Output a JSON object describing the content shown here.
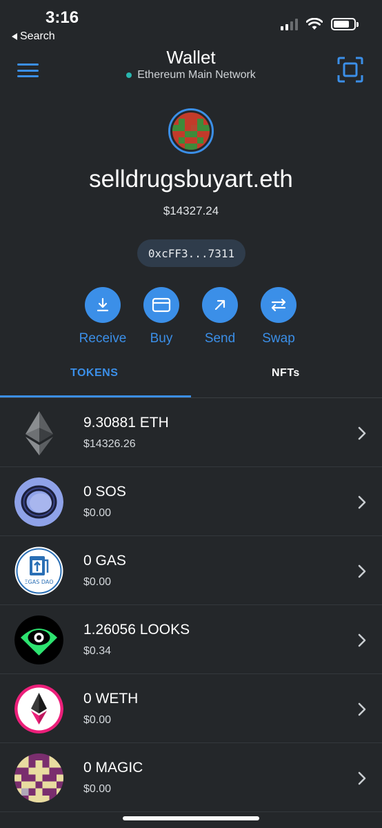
{
  "status_bar": {
    "time": "3:16",
    "back_label": "Search"
  },
  "header": {
    "title": "Wallet",
    "network": "Ethereum Main Network"
  },
  "account": {
    "name": "selldrugsbuyart.eth",
    "balance": "$14327.24",
    "address": "0xcFF3...7311"
  },
  "actions": [
    {
      "label": "Receive",
      "icon": "download-icon"
    },
    {
      "label": "Buy",
      "icon": "card-icon"
    },
    {
      "label": "Send",
      "icon": "arrow-up-right-icon"
    },
    {
      "label": "Swap",
      "icon": "swap-icon"
    }
  ],
  "tabs": [
    {
      "label": "TOKENS",
      "active": true
    },
    {
      "label": "NFTs",
      "active": false
    }
  ],
  "tokens": [
    {
      "amount": "9.30881 ETH",
      "fiat": "$14326.26",
      "icon": "ethereum-icon"
    },
    {
      "amount": "0 SOS",
      "fiat": "$0.00",
      "icon": "sos-icon"
    },
    {
      "amount": "0 GAS",
      "fiat": "$0.00",
      "icon": "gas-dao-icon",
      "icon_text": "ΞGAS DAO"
    },
    {
      "amount": "1.26056 LOOKS",
      "fiat": "$0.34",
      "icon": "looks-icon"
    },
    {
      "amount": "0 WETH",
      "fiat": "$0.00",
      "icon": "weth-icon"
    },
    {
      "amount": "0 MAGIC",
      "fiat": "$0.00",
      "icon": "magic-icon"
    }
  ],
  "colors": {
    "accent": "#3b8fe8",
    "background": "#24272a",
    "network_dot": "#29b6af"
  }
}
